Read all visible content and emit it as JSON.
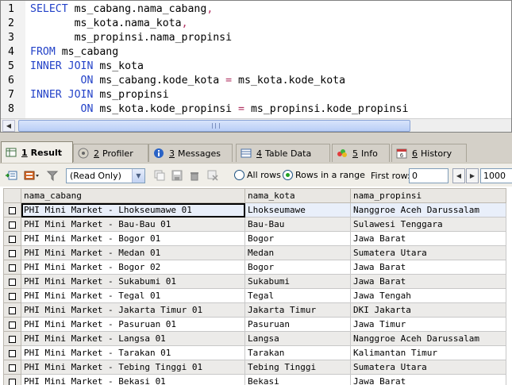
{
  "editor": {
    "line_numbers": [
      "1",
      "2",
      "3",
      "4",
      "5",
      "6",
      "7",
      "8"
    ],
    "lines": [
      [
        {
          "t": "SELECT",
          "c": "kw"
        },
        {
          "t": " ms_cabang.nama_cabang",
          "c": "txt"
        },
        {
          "t": ",",
          "c": "pun"
        }
      ],
      [
        {
          "t": "       ms_kota.nama_kota",
          "c": "txt"
        },
        {
          "t": ",",
          "c": "pun"
        }
      ],
      [
        {
          "t": "       ms_propinsi.nama_propinsi",
          "c": "txt"
        }
      ],
      [
        {
          "t": "FROM",
          "c": "kw"
        },
        {
          "t": " ms_cabang",
          "c": "txt"
        }
      ],
      [
        {
          "t": "INNER JOIN",
          "c": "kw"
        },
        {
          "t": " ms_kota",
          "c": "txt"
        }
      ],
      [
        {
          "t": "        ",
          "c": "txt"
        },
        {
          "t": "ON",
          "c": "kw2"
        },
        {
          "t": " ms_cabang.kode_kota ",
          "c": "txt"
        },
        {
          "t": "=",
          "c": "pun"
        },
        {
          "t": " ms_kota.kode_kota",
          "c": "txt"
        }
      ],
      [
        {
          "t": "INNER JOIN",
          "c": "kw"
        },
        {
          "t": " ms_propinsi",
          "c": "txt"
        }
      ],
      [
        {
          "t": "        ",
          "c": "txt"
        },
        {
          "t": "ON",
          "c": "kw2"
        },
        {
          "t": " ms_kota.kode_propinsi ",
          "c": "txt"
        },
        {
          "t": "=",
          "c": "pun"
        },
        {
          "t": " ms_propinsi.kode_propinsi",
          "c": "txt"
        }
      ]
    ]
  },
  "tabs": [
    {
      "num": "1",
      "label": "Result",
      "icon": "result-grid-icon",
      "active": true
    },
    {
      "num": "2",
      "label": "Profiler",
      "icon": "profiler-icon",
      "active": false
    },
    {
      "num": "3",
      "label": "Messages",
      "icon": "messages-icon",
      "active": false
    },
    {
      "num": "4",
      "label": "Table Data",
      "icon": "table-data-icon",
      "active": false
    },
    {
      "num": "5",
      "label": "Info",
      "icon": "info-icon",
      "active": false
    },
    {
      "num": "6",
      "label": "History",
      "icon": "history-icon",
      "active": false
    }
  ],
  "toolbar": {
    "mode_select": "(Read Only)",
    "all_rows_label": "All rows",
    "rows_in_range_label": "Rows in a range",
    "selected_radio": "rows_in_range",
    "first_row_label": "First row:",
    "first_row_value": "0",
    "rows_value": "1000"
  },
  "grid": {
    "columns": [
      "nama_cabang",
      "nama_kota",
      "nama_propinsi"
    ],
    "rows": [
      [
        "PHI Mini Market - Lhokseumawe 01",
        "Lhokseumawe",
        "Nanggroe Aceh Darussalam"
      ],
      [
        "PHI Mini Market - Bau-Bau 01",
        "Bau-Bau",
        "Sulawesi Tenggara"
      ],
      [
        "PHI Mini Market - Bogor 01",
        "Bogor",
        "Jawa Barat"
      ],
      [
        "PHI Mini Market - Medan 01",
        "Medan",
        "Sumatera Utara"
      ],
      [
        "PHI Mini Market - Bogor 02",
        "Bogor",
        "Jawa Barat"
      ],
      [
        "PHI Mini Market - Sukabumi 01",
        "Sukabumi",
        "Jawa Barat"
      ],
      [
        "PHI Mini Market - Tegal 01",
        "Tegal",
        "Jawa Tengah"
      ],
      [
        "PHI Mini Market - Jakarta Timur 01",
        "Jakarta Timur",
        "DKI Jakarta"
      ],
      [
        "PHI Mini Market - Pasuruan 01",
        "Pasuruan",
        "Jawa Timur"
      ],
      [
        "PHI Mini Market - Langsa 01",
        "Langsa",
        "Nanggroe Aceh Darussalam"
      ],
      [
        "PHI Mini Market - Tarakan 01",
        "Tarakan",
        "Kalimantan Timur"
      ],
      [
        "PHI Mini Market - Tebing Tinggi 01",
        "Tebing Tinggi",
        "Sumatera Utara"
      ],
      [
        "PHI Mini Market - Bekasi 01",
        "Bekasi",
        "Jawa Barat"
      ]
    ]
  }
}
